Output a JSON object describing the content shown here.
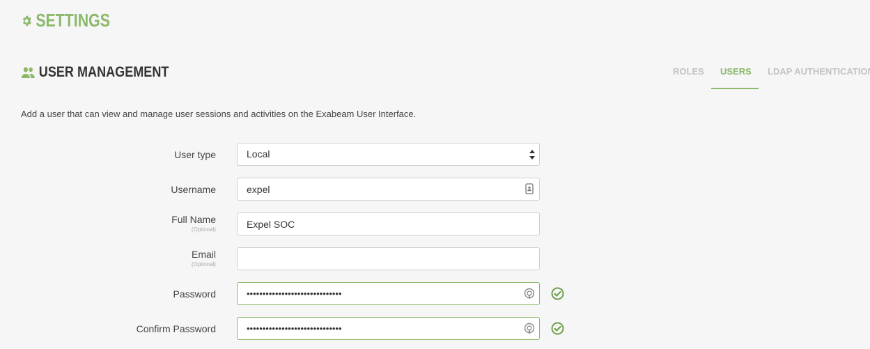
{
  "page": {
    "title": "SETTINGS"
  },
  "section": {
    "title": "USER MANAGEMENT"
  },
  "tabs": [
    {
      "label": "ROLES",
      "active": false
    },
    {
      "label": "USERS",
      "active": true
    },
    {
      "label": "LDAP AUTHENTICATION",
      "active": false
    }
  ],
  "description": "Add a user that can view and manage user sessions and activities on the Exabeam User Interface.",
  "form": {
    "user_type": {
      "label": "User type",
      "value": "Local"
    },
    "username": {
      "label": "Username",
      "value": "expel"
    },
    "full_name": {
      "label": "Full Name",
      "optional": "(Optional)",
      "value": "Expel SOC"
    },
    "email": {
      "label": "Email",
      "optional": "(Optional)",
      "value": ""
    },
    "password": {
      "label": "Password",
      "value": "••••••••••••••••••••••••••••••"
    },
    "confirm_password": {
      "label": "Confirm Password",
      "value": "••••••••••••••••••••••••••••••"
    }
  },
  "colors": {
    "accent": "#8cb86a",
    "background": "#f6f6f6",
    "tab_inactive": "#c3c3c3"
  },
  "icons": [
    "gear-icon",
    "users-icon",
    "sort-arrows-icon",
    "contact-card-icon",
    "password-reveal-icon",
    "check-circle-icon"
  ]
}
